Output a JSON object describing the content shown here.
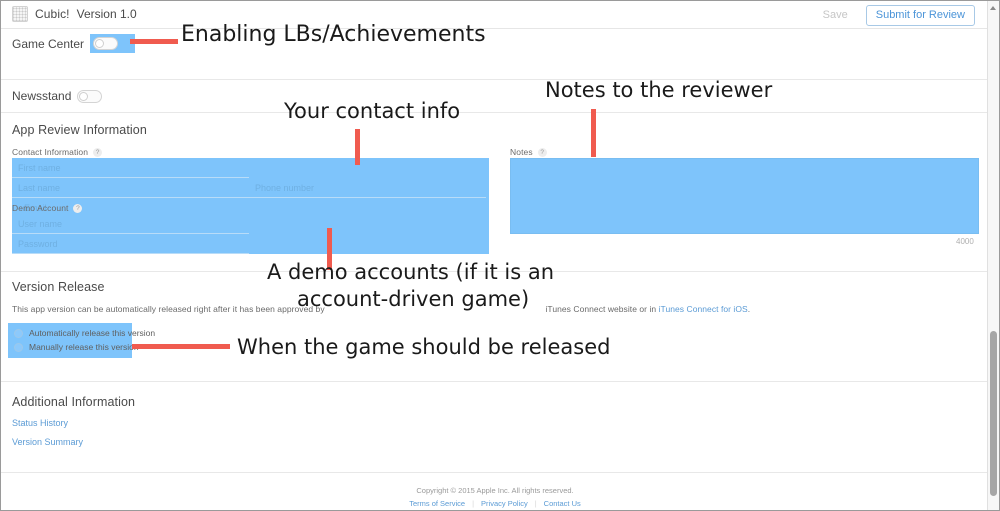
{
  "window": {
    "app_name": "Cubic!",
    "app_version_label": "Version 1.0",
    "app_icon": "cubic-app-icon"
  },
  "toolbar": {
    "save_label": "Save",
    "submit_label": "Submit for Review"
  },
  "toggles": [
    {
      "label": "Game Center",
      "state": "off",
      "highlighted": true
    },
    {
      "label": "Newsstand",
      "state": "off",
      "highlighted": false
    }
  ],
  "app_review": {
    "section_title": "App Review Information",
    "contact_information": {
      "label": "Contact Information",
      "help_glyph": "?",
      "fields": [
        {
          "name": "first-name",
          "placeholder": "First name",
          "value": ""
        },
        {
          "name": "last-name",
          "placeholder": "Last name",
          "value": ""
        },
        {
          "name": "phone-number",
          "placeholder": "Phone number",
          "value": ""
        },
        {
          "name": "email",
          "placeholder": "Email",
          "value": ""
        }
      ]
    },
    "demo_account": {
      "label": "Demo Account",
      "help_glyph": "?",
      "fields": [
        {
          "name": "user-name",
          "placeholder": "User name",
          "value": ""
        },
        {
          "name": "password",
          "placeholder": "Password",
          "value": ""
        }
      ]
    },
    "notes": {
      "label": "Notes",
      "help_glyph": "?",
      "value": "",
      "char_limit": "4000"
    }
  },
  "version_release": {
    "section_title": "Version Release",
    "description_before_link": "This app version can be automatically released right after it has been approved by App Review, or you can manually release it from the iTunes Connect website or in ",
    "description_link": "iTunes Connect for iOS",
    "description_after_link": ".",
    "description_visible_start": "This app version can be automatically released right after it has been approved by",
    "description_visible_end": "iTunes Connect website or in",
    "options": [
      {
        "label": "Automatically release this version",
        "selected": false
      },
      {
        "label": "Manually release this version",
        "selected": false
      }
    ]
  },
  "additional_information": {
    "section_title": "Additional Information",
    "links": [
      {
        "label": "Status History"
      },
      {
        "label": "Version Summary"
      }
    ]
  },
  "footer": {
    "copyright": "Copyright © 2015 Apple Inc. All rights reserved.",
    "links": [
      {
        "label": "Terms of Service"
      },
      {
        "label": "Privacy Policy"
      },
      {
        "label": "Contact Us"
      }
    ],
    "separator": "|"
  },
  "annotations": [
    {
      "text": "Enabling LBs/Achievements"
    },
    {
      "text": "Notes to the reviewer"
    },
    {
      "text": "Your contact info"
    },
    {
      "text": "A demo accounts (if it is an"
    },
    {
      "text": "account-driven game)"
    },
    {
      "text": "When the game should be released"
    }
  ],
  "colors": {
    "selection_blue": "#7ec4fb",
    "annotation_red": "#f05b4f",
    "link_blue": "#5b9bd5"
  }
}
